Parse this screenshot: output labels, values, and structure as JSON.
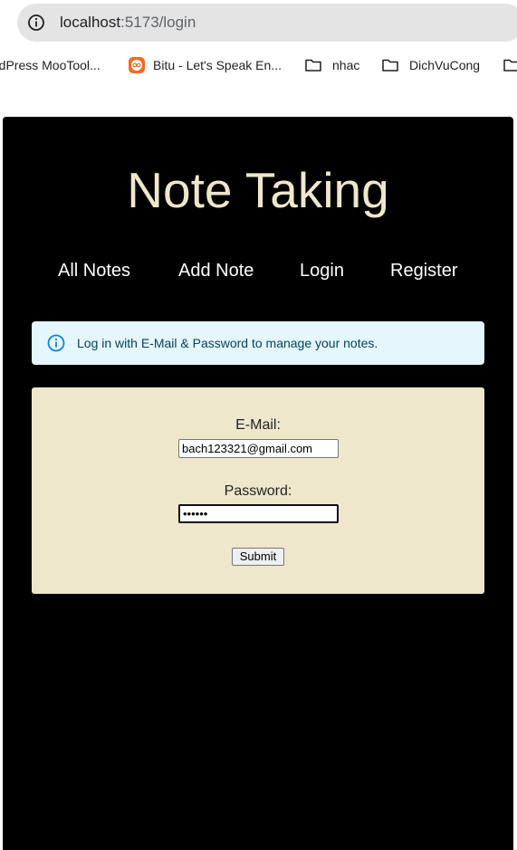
{
  "browser": {
    "url_host": "localhost",
    "url_rest": ":5173/login",
    "bookmarks": [
      {
        "label": "rdPress MooTool...",
        "icon": "none"
      },
      {
        "label": "Bitu - Let's Speak En...",
        "icon": "bitu-favicon"
      },
      {
        "label": "nhac",
        "icon": "folder-icon"
      },
      {
        "label": "DichVuCong",
        "icon": "folder-icon"
      }
    ]
  },
  "app": {
    "title": "Note Taking",
    "nav": [
      "All Notes",
      "Add Note",
      "Login",
      "Register"
    ],
    "alert": {
      "text": "Log in with E-Mail & Password to manage your notes.",
      "icon": "info-outline-icon",
      "color": "#0288d1"
    },
    "form": {
      "email_label": "E-Mail:",
      "email_value": "bach123321@gmail.com",
      "password_label": "Password:",
      "password_value": "123456",
      "submit_label": "Submit"
    },
    "colors": {
      "page_bg": "#000000",
      "accent": "#eee7cc",
      "alert_bg": "#e5f6fd",
      "alert_text": "#014361"
    }
  }
}
